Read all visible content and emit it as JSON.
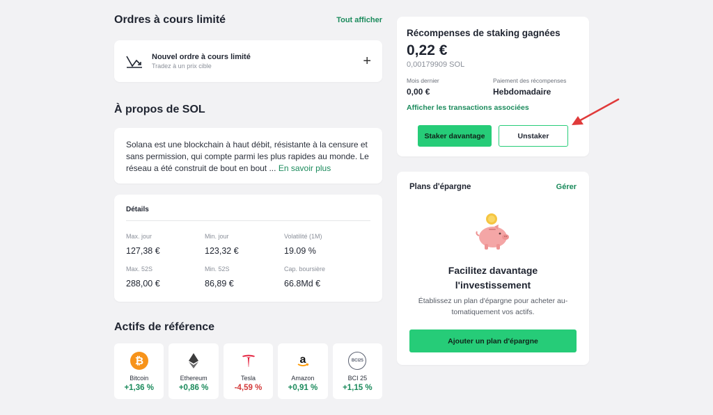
{
  "limit_orders": {
    "title": "Ordres à cours limité",
    "show_all": "Tout afficher",
    "new_order_title": "Nouvel ordre à cours limité",
    "new_order_subtitle": "Tradez à un prix cible",
    "add_symbol": "+"
  },
  "about": {
    "title": "À propos de SOL",
    "text": "Solana est une blockchain à haut débit, résistante à la censure et sans permission, qui compte parmi les plus rapides au monde. Le réseau a été construit de bout en bout ...",
    "more_link": "En savoir plus"
  },
  "details": {
    "title": "Détails",
    "stats": [
      {
        "label": "Max. jour",
        "value": "127,38 €"
      },
      {
        "label": "Min. jour",
        "value": "123,32 €"
      },
      {
        "label": "Volatilité (1M)",
        "value": "19.09 %"
      },
      {
        "label": "Max. 52S",
        "value": "288,00 €"
      },
      {
        "label": "Min. 52S",
        "value": "86,89 €"
      },
      {
        "label": "Cap. boursière",
        "value": "66.8Md €"
      }
    ]
  },
  "reference_assets": {
    "title": "Actifs de référence",
    "items": [
      {
        "name": "Bitcoin",
        "change": "+1,36 %",
        "icon": "bitcoin-icon",
        "color": "#f7931a"
      },
      {
        "name": "Ethereum",
        "change": "+0,86 %",
        "icon": "ethereum-icon",
        "color": "#3c3c3d"
      },
      {
        "name": "Tesla",
        "change": "-4,59 %",
        "icon": "tesla-icon",
        "color": "#e31937"
      },
      {
        "name": "Amazon",
        "change": "+0,91 %",
        "icon": "amazon-icon",
        "color": "#ff9900"
      },
      {
        "name": "BCI 25",
        "change": "+1,15 %",
        "icon": "bci25-icon",
        "color": "#5a6070"
      }
    ]
  },
  "staking": {
    "title": "Récompenses de staking gagnées",
    "amount_eur": "0,22 €",
    "amount_sol": "0,00179909 SOL",
    "last_month_label": "Mois dernier",
    "last_month_value": "0,00 €",
    "payout_label": "Paiement des récompenses",
    "payout_value": "Hebdomadaire",
    "transactions_link": "Afficher les transactions associées",
    "stake_more": "Staker davantage",
    "unstake": "Unstaker"
  },
  "savings": {
    "title": "Plans d'épargne",
    "manage": "Gérer",
    "headline_line1": "Facilitez davantage",
    "headline_line2": "l'investissement",
    "description": "Établissez un plan d'épargne pour acheter au-tomatiquement vos actifs.",
    "cta": "Ajouter un plan d'épargne",
    "bci_icon_text": "BCI25"
  },
  "colors": {
    "accent_green": "#26cc78",
    "link_green": "#1a8a5b",
    "negative_red": "#d33a3a"
  }
}
